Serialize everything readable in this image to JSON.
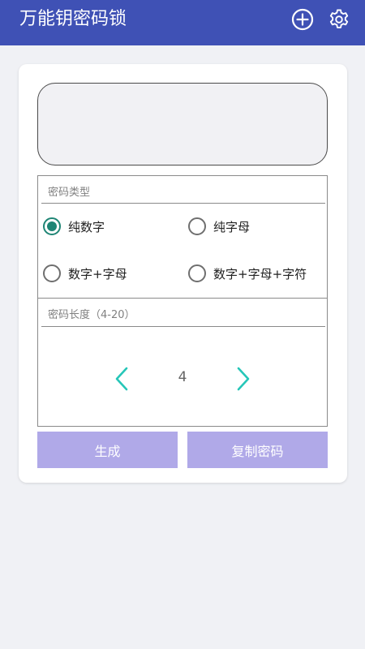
{
  "app": {
    "title": "万能钥密码锁",
    "icons": {
      "add": "add-circle-icon",
      "settings": "gear-icon"
    },
    "colors": {
      "appbar": "#3f51b5",
      "accent": "#1f8575",
      "arrow": "#26c6b8",
      "button": "#b0a9e8"
    }
  },
  "password": {
    "value": ""
  },
  "type_section": {
    "label": "密码类型",
    "options": [
      {
        "label": "纯数字",
        "checked": true
      },
      {
        "label": "纯字母",
        "checked": false
      },
      {
        "label": "数字+字母",
        "checked": false
      },
      {
        "label": "数字+字母+字符",
        "checked": false
      }
    ]
  },
  "length_section": {
    "label": "密码长度（4-20）",
    "value": "4",
    "icons": {
      "decrease": "chevron-left-icon",
      "increase": "chevron-right-icon"
    }
  },
  "actions": {
    "generate": "生成",
    "copy": "复制密码"
  }
}
